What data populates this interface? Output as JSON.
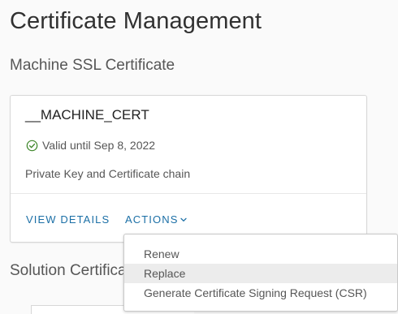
{
  "page": {
    "title": "Certificate Management",
    "section_machine": "Machine SSL Certificate",
    "section_solution": "Solution Certifica"
  },
  "card": {
    "name": "__MACHINE_CERT",
    "status": "Valid until Sep 8, 2022",
    "status_color": "#3c8527",
    "description": "Private Key and Certificate chain",
    "view_details_label": "VIEW DETAILS",
    "actions_label": "ACTIONS",
    "link_color": "#1b6fa6"
  },
  "actions_menu": {
    "items": [
      {
        "label": "Renew"
      },
      {
        "label": "Replace",
        "highlighted": true
      },
      {
        "label": "Generate Certificate Signing Request (CSR)"
      }
    ]
  },
  "icons": {
    "status": "check-circle-icon",
    "actions_caret": "chevron-down-icon"
  }
}
